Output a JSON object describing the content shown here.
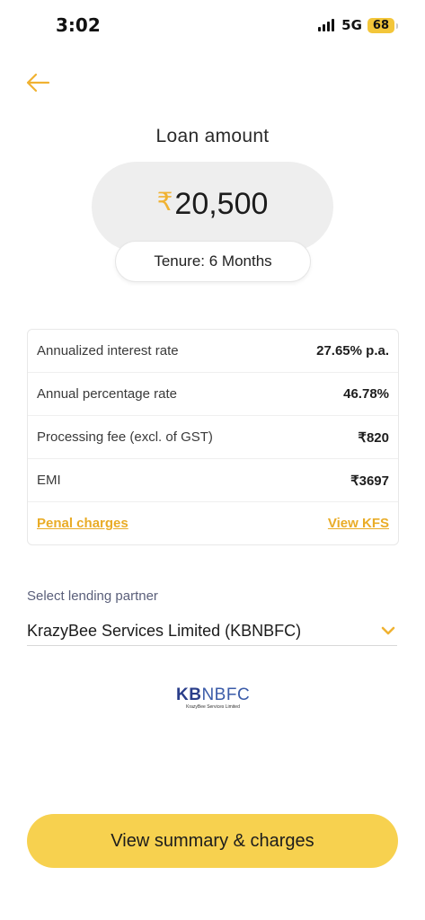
{
  "status_bar": {
    "time": "3:02",
    "network": "5G",
    "battery": "68"
  },
  "header": {
    "back_icon": "arrow-left-icon"
  },
  "loan": {
    "title": "Loan amount",
    "currency_symbol": "₹",
    "amount": "20,500",
    "tenure": "Tenure: 6 Months"
  },
  "rates": {
    "rows": [
      {
        "label": "Annualized interest rate",
        "value": "27.65% p.a."
      },
      {
        "label": "Annual percentage rate",
        "value": "46.78%"
      },
      {
        "label": "Processing fee (excl. of GST)",
        "value": "₹820"
      },
      {
        "label": "EMI",
        "value": "₹3697"
      }
    ],
    "penal_charges_link": "Penal charges",
    "view_kfs_link": "View KFS"
  },
  "partner": {
    "label": "Select lending partner",
    "selected": "KrazyBee Services Limited (KBNBFC)",
    "logo_kb": "KB",
    "logo_nbfc": "NBFC",
    "logo_subtitle": "KrazyBee Services Limited"
  },
  "actions": {
    "summary_button": "View summary & charges"
  },
  "colors": {
    "accent": "#f0b232",
    "button": "#f7d14f",
    "link": "#e9ac27"
  }
}
